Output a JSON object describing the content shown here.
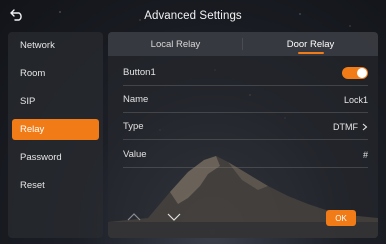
{
  "header": {
    "title": "Advanced Settings",
    "back_icon": "back-arrow-icon"
  },
  "sidebar": {
    "items": [
      {
        "label": "Network",
        "active": false
      },
      {
        "label": "Room",
        "active": false
      },
      {
        "label": "SIP",
        "active": false
      },
      {
        "label": "Relay",
        "active": true
      },
      {
        "label": "Password",
        "active": false
      },
      {
        "label": "Reset",
        "active": false
      }
    ]
  },
  "tabs": [
    {
      "label": "Local Relay",
      "active": false
    },
    {
      "label": "Door Relay",
      "active": true
    }
  ],
  "form": {
    "button1_label": "Button1",
    "button1_enabled": true,
    "name_label": "Name",
    "name_value": "Lock1",
    "type_label": "Type",
    "type_value": "DTMF",
    "value_label": "Value",
    "value_value": "#"
  },
  "footer": {
    "up_icon": "chevron-up-icon",
    "down_icon": "chevron-down-icon",
    "ok_label": "OK"
  },
  "colors": {
    "accent": "#f07b17",
    "background": "#1c1f26"
  }
}
